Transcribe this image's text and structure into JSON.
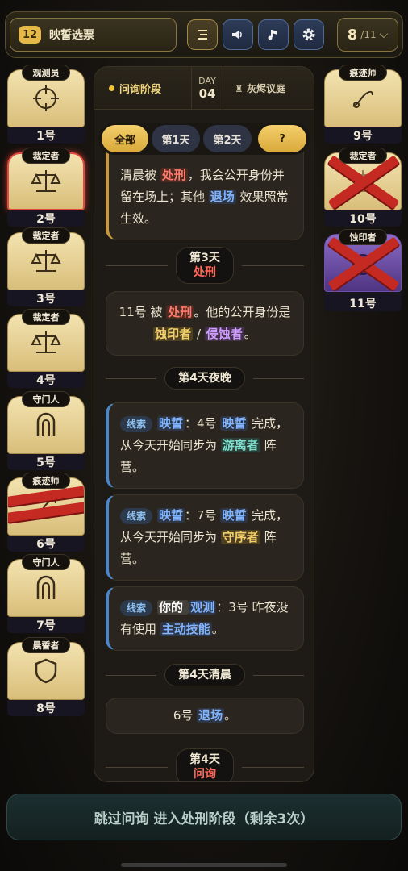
{
  "header": {
    "badge": "12",
    "title": "映誓选票",
    "counter_current": "8",
    "counter_total": "/11",
    "chevron": "⌄",
    "buttons": [
      "menu-icon",
      "volume-icon",
      "music-icon",
      "gear-icon"
    ]
  },
  "phase_bar": {
    "phase": "问询阶段",
    "day_label": "DAY",
    "day_num": "04",
    "location": "灰烬议庭"
  },
  "filters": [
    "全部",
    "第1天",
    "第2天",
    "?"
  ],
  "left_players": [
    {
      "role": "观测员",
      "num": "1号",
      "icon": "crosshair-icon"
    },
    {
      "role": "裁定者",
      "num": "2号",
      "icon": "scales-icon",
      "highlight": true
    },
    {
      "role": "裁定者",
      "num": "3号",
      "icon": "scales-icon"
    },
    {
      "role": "裁定者",
      "num": "4号",
      "icon": "scales-icon"
    },
    {
      "role": "守门人",
      "num": "5号",
      "icon": "gate-icon"
    },
    {
      "role": "痕迹师",
      "num": "6号",
      "icon": "trace-icon",
      "crossed": true
    },
    {
      "role": "守门人",
      "num": "7号",
      "icon": "gate-icon"
    },
    {
      "role": "晨誓者",
      "num": "8号",
      "icon": "shield-icon"
    }
  ],
  "right_players": [
    {
      "role": "痕迹师",
      "num": "9号",
      "icon": "trace-icon"
    },
    {
      "role": "裁定者",
      "num": "10号",
      "icon": "scales-icon",
      "crossed": true
    },
    {
      "role": "蚀印者",
      "num": "11号",
      "icon": "eclipse-icon",
      "crossed": true,
      "purple": true
    }
  ],
  "log": {
    "msg1": {
      "a": "清晨被 ",
      "b": "处刑",
      "c": "，我会公开身份并留在场上；其他 ",
      "d": "退场",
      "e": " 效果照常生效。"
    },
    "div1": {
      "title": "第3天",
      "sub": "处刑"
    },
    "msg2": {
      "a": "11号 被 ",
      "b": "处刑",
      "c": "。他的公开身份是 ",
      "d": "蚀印者",
      "e": " / ",
      "f": "侵蚀者",
      "g": "。"
    },
    "div2": {
      "title": "第4天夜晚"
    },
    "msg3": {
      "tag": "线索",
      "a": "映誓",
      "b": "：4号 ",
      "c": "映誓",
      "d": " 完成，从今天开始同步为 ",
      "e": "游离者",
      "f": " 阵营。"
    },
    "msg4": {
      "tag": "线索",
      "a": "映誓",
      "b": "：7号 ",
      "c": "映誓",
      "d": " 完成，从今天开始同步为 ",
      "e": "守序者",
      "f": " 阵营。"
    },
    "msg5": {
      "tag": "线索",
      "a": "你的 ",
      "b": "观测",
      "c": "：3号 昨夜没有使用 ",
      "d": "主动技能",
      "e": "。"
    },
    "div3": {
      "title": "第4天清晨"
    },
    "msg6": {
      "a": "6号 ",
      "b": "退场",
      "c": "。"
    },
    "div4": {
      "title": "第4天",
      "sub": "问询"
    }
  },
  "bottom_button": "跳过问询 进入处刑阶段（剩余3次）"
}
